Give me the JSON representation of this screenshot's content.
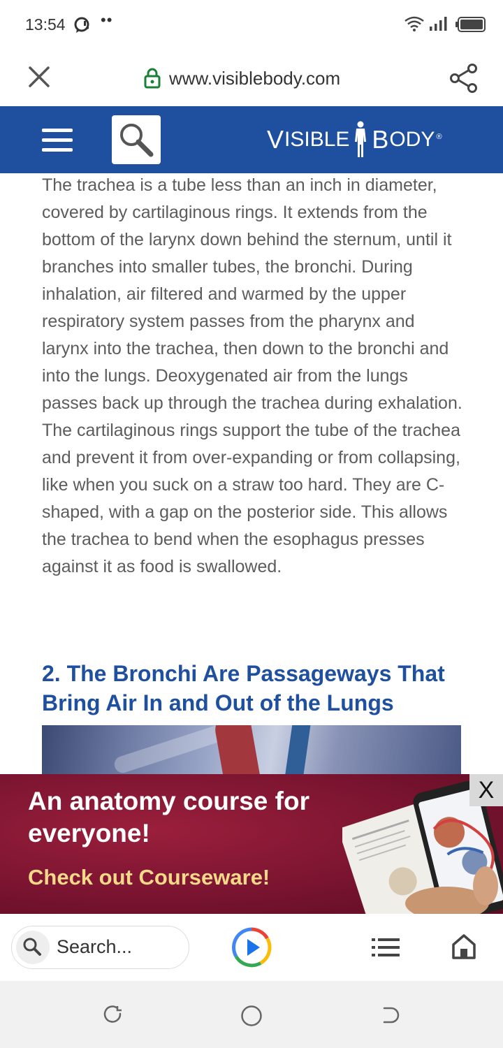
{
  "status_bar": {
    "time": "13:54",
    "dots": "••",
    "icons": [
      "chat-icon",
      "wifi-icon",
      "signal-icon",
      "battery-icon"
    ]
  },
  "address_bar": {
    "url": "www.visiblebody.com",
    "icons": [
      "close-icon",
      "lock-icon",
      "share-icon"
    ]
  },
  "site_header": {
    "brand_v": "V",
    "brand_isible": "ISIBLE",
    "brand_b": "B",
    "brand_ody": "ODY",
    "brand_reg": "®",
    "background": "#1f4f9f"
  },
  "article": {
    "paragraph": "The trachea is a tube less than an inch in diameter, covered by cartilaginous rings. It extends from the bottom of the larynx down behind the sternum, until it branches into smaller tubes, the bronchi. During inhalation, air filtered and warmed by the upper respiratory system passes from the pharynx and larynx into the trachea, then down to the bronchi and into the lungs. Deoxygenated air from the lungs passes back up through the trachea during exhalation. The cartilaginous rings support the tube of the trachea and prevent it from over-expanding or from collapsing, like when you suck on a straw too hard. They are C-shaped, with a gap on the posterior side. This allows the trachea to bend when the esophagus presses against it as food is swallowed.",
    "heading": "2. The Bronchi Are Passageways That Bring Air In and Out of the Lungs",
    "heading_color": "#1f4f9f"
  },
  "ad": {
    "headline": "An anatomy course for everyone!",
    "cta": "Check out Courseware!",
    "close": "X",
    "cta_color": "#f5d98a"
  },
  "toolbar": {
    "search_placeholder": "Search...",
    "icons": [
      "search-icon",
      "play-icon",
      "list-icon",
      "home-icon"
    ]
  },
  "system_nav": {
    "icons": [
      "recents-icon",
      "home-circle-icon",
      "back-icon"
    ]
  }
}
